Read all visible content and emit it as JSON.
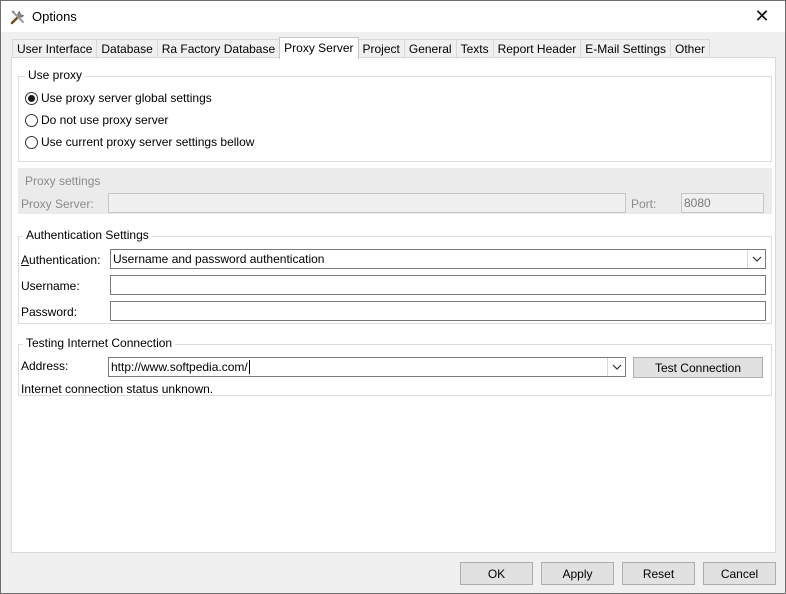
{
  "window": {
    "title": "Options",
    "icon": "tools-icon"
  },
  "tabs": [
    {
      "label": "User Interface"
    },
    {
      "label": "Database"
    },
    {
      "label": "Ra Factory Database"
    },
    {
      "label": "Proxy Server",
      "active": true
    },
    {
      "label": "Project"
    },
    {
      "label": "General"
    },
    {
      "label": "Texts"
    },
    {
      "label": "Report Header"
    },
    {
      "label": "E-Mail Settings"
    },
    {
      "label": "Other"
    }
  ],
  "use_proxy": {
    "label": "Use proxy",
    "options": [
      {
        "label": "Use proxy server global settings",
        "checked": true
      },
      {
        "label": "Do not use proxy server",
        "checked": false
      },
      {
        "label": "Use current proxy server settings bellow",
        "checked": false
      }
    ]
  },
  "proxy_settings": {
    "label": "Proxy settings",
    "server_label": "Proxy Server:",
    "server_value": "",
    "port_label": "Port:",
    "port_value": "8080"
  },
  "authentication": {
    "label": "Authentication Settings",
    "auth_label_first": "A",
    "auth_label_rest": "uthentication:",
    "auth_value": "Username and password authentication",
    "username_label": "Username:",
    "username_value": "",
    "password_label": "Password:",
    "password_value": ""
  },
  "testing": {
    "label": "Testing Internet Connection",
    "address_label": "Address:",
    "address_value": "http://www.softpedia.com/",
    "test_button": "Test Connection",
    "status": "Internet connection status unknown."
  },
  "footer": {
    "ok": "OK",
    "apply": "Apply",
    "reset": "Reset",
    "cancel": "Cancel"
  }
}
